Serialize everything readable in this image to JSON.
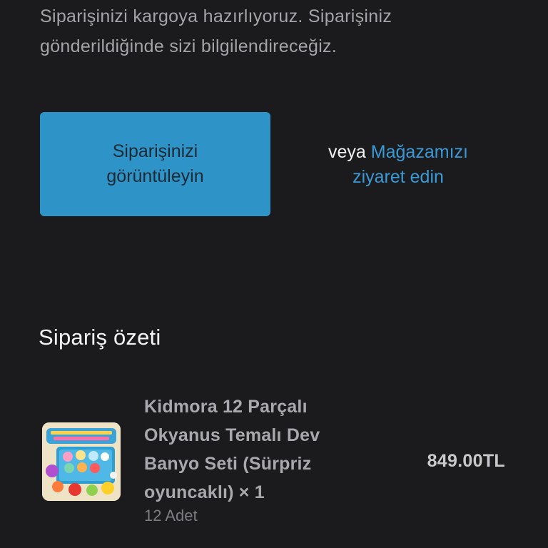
{
  "intro": {
    "text": "Siparişinizi kargoya hazırlıyoruz. Siparişiniz gönderildiğinde sizi bilgilendireceğiz."
  },
  "actions": {
    "view_order_label": "Siparişinizi görüntüleyin",
    "or_text": "veya",
    "store_link_label": "Mağazamızı ziyaret edin"
  },
  "summary": {
    "title": "Sipariş özeti",
    "items": [
      {
        "name": "Kidmora 12 Parçalı Okyanus Temalı Dev Banyo Seti (Sürpriz oyuncaklı) × 1",
        "quantity_text": "12 Adet",
        "price": "849.00TL",
        "image_icon": "bath-bomb-set-product-image"
      }
    ]
  },
  "colors": {
    "background": "#1b1b1e",
    "button": "#2e94c8",
    "link": "#3a9ad6"
  }
}
